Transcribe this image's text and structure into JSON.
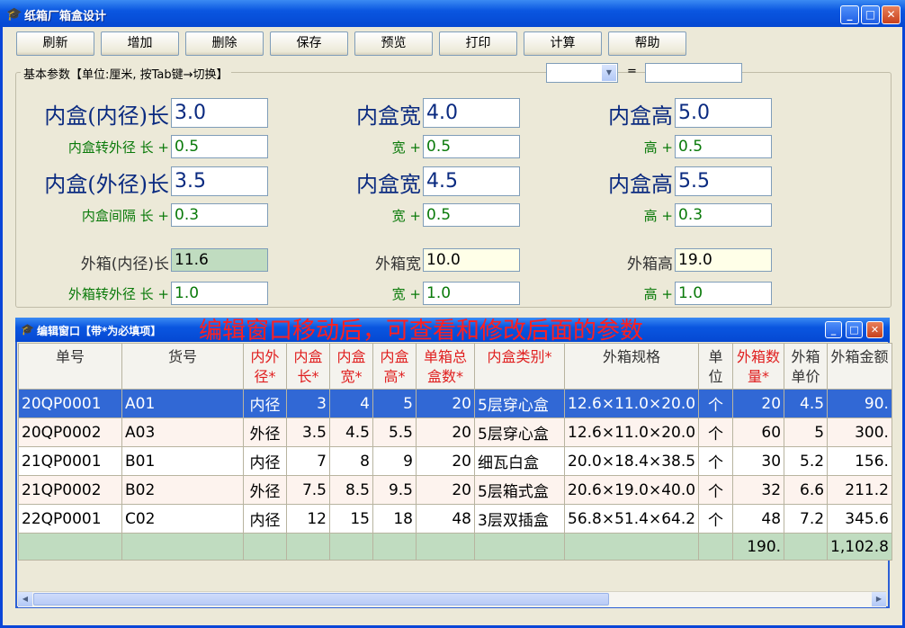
{
  "window": {
    "title": "纸箱厂箱盒设计",
    "minimize": "_",
    "maximize": "□",
    "close": "✕"
  },
  "toolbar": [
    "刷新",
    "增加",
    "删除",
    "保存",
    "预览",
    "打印",
    "计算",
    "帮助"
  ],
  "params": {
    "group_label": "基本参数【单位:厘米, 按Tab键→切换】",
    "equals": "=",
    "combo_value": "",
    "result_value": "",
    "row1": {
      "l_label": "内盒(内径)长",
      "l_value": "3.0",
      "w_label": "内盒宽",
      "w_value": "4.0",
      "h_label": "内盒高",
      "h_value": "5.0"
    },
    "row2": {
      "l_label": "内盒转外径  长 +",
      "l_value": "0.5",
      "w_label": "宽 +",
      "w_value": "0.5",
      "h_label": "高 +",
      "h_value": "0.5"
    },
    "row3": {
      "l_label": "内盒(外径)长",
      "l_value": "3.5",
      "w_label": "内盒宽",
      "w_value": "4.5",
      "h_label": "内盒高",
      "h_value": "5.5"
    },
    "row4": {
      "l_label": "内盒间隔  长 +",
      "l_value": "0.3",
      "w_label": "宽 +",
      "w_value": "0.5",
      "h_label": "高 +",
      "h_value": "0.3"
    },
    "row5": {
      "l_label": "外箱(内径)长",
      "l_value": "11.6",
      "w_label": "外箱宽",
      "w_value": "10.0",
      "h_label": "外箱高",
      "h_value": "19.0"
    },
    "row6": {
      "l_label": "外箱转外径  长 +",
      "l_value": "1.0",
      "w_label": "宽 +",
      "w_value": "1.0",
      "h_label": "高 +",
      "h_value": "1.0"
    }
  },
  "editor": {
    "title": "编辑窗口【带*为必填项】",
    "hint": "编辑窗口移动后，可查看和修改后面的参数",
    "columns": [
      "单号",
      "货号",
      "内外径*",
      "内盒长*",
      "内盒宽*",
      "内盒高*",
      "单箱总盒数*",
      "内盒类别*",
      "外箱规格",
      "单位",
      "外箱数量*",
      "外箱单价",
      "外箱金额"
    ],
    "rows": [
      [
        "20QP0001",
        "A01",
        "内径",
        "3",
        "4",
        "5",
        "20",
        "5层穿心盒",
        "12.6×11.0×20.0",
        "个",
        "20",
        "4.5",
        "90."
      ],
      [
        "20QP0002",
        "A03",
        "外径",
        "3.5",
        "4.5",
        "5.5",
        "20",
        "5层穿心盒",
        "12.6×11.0×20.0",
        "个",
        "60",
        "5",
        "300."
      ],
      [
        "21QP0001",
        "B01",
        "内径",
        "7",
        "8",
        "9",
        "20",
        "细瓦白盒",
        "20.0×18.4×38.5",
        "个",
        "30",
        "5.2",
        "156."
      ],
      [
        "21QP0002",
        "B02",
        "外径",
        "7.5",
        "8.5",
        "9.5",
        "20",
        "5层箱式盒",
        "20.6×19.0×40.0",
        "个",
        "32",
        "6.6",
        "211.2"
      ],
      [
        "22QP0001",
        "C02",
        "内径",
        "12",
        "15",
        "18",
        "48",
        "3层双插盒",
        "56.8×51.4×64.2",
        "个",
        "48",
        "7.2",
        "345.6"
      ]
    ],
    "totals": {
      "qty": "190.",
      "amount": "1,102.8"
    }
  }
}
